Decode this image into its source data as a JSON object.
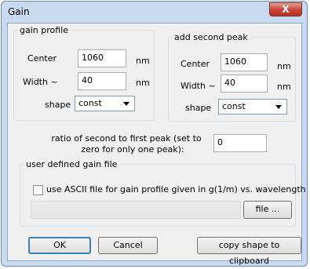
{
  "window": {
    "title": "Gain",
    "close_glyph": "X"
  },
  "gain_profile": {
    "legend": "gain profile",
    "center_label": "Center",
    "center_value": "1060",
    "center_unit": "nm",
    "width_label": "Width ~",
    "width_value": "40",
    "width_unit": "nm",
    "shape_label": "shape",
    "shape_value": "const"
  },
  "second_peak": {
    "legend": "add second peak",
    "center_label": "Center",
    "center_value": "1060",
    "center_unit": "nm",
    "width_label": "Width ~",
    "width_value": "40",
    "width_unit": "nm",
    "shape_label": "shape",
    "shape_value": "const"
  },
  "ratio": {
    "label_line1": "ratio of second to first peak (set to",
    "label_line2": "zero for only one peak):",
    "value": "0"
  },
  "user_file": {
    "legend": "user defined gain file",
    "checkbox_label": "use ASCII file for gain profile given in g(1/m) vs. wavelength",
    "file_button": "file ..."
  },
  "buttons": {
    "ok": "OK",
    "cancel": "Cancel",
    "copy": "copy shape to clipboard"
  }
}
